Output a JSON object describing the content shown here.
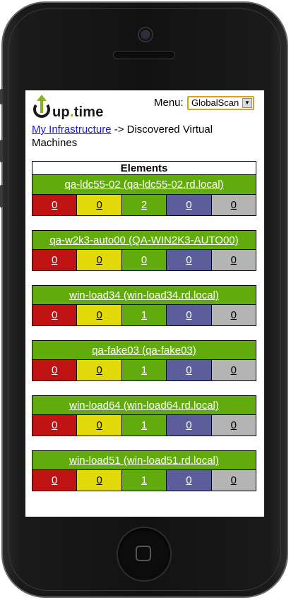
{
  "app": {
    "logo_text_a": "up",
    "logo_dot": ".",
    "logo_text_b": "time",
    "menu_label": "Menu:",
    "menu_selected": "GlobalScan"
  },
  "breadcrumb": {
    "link": "My Infrastructure",
    "rest": " -> Discovered Virtual Machines"
  },
  "elements_header": "Elements",
  "colors": {
    "critical": "#c01414",
    "warning": "#e2d90b",
    "ok": "#62ab0d",
    "maintenance": "#5c5e9c",
    "unknown": "#b4b4b4"
  },
  "vms": [
    {
      "title": "qa-ldc55-02 (qa-ldc55-02.rd.local)",
      "counts": [
        "0",
        "0",
        "2",
        "0",
        "0"
      ]
    },
    {
      "title": "qa-w2k3-auto00 (QA-WIN2K3-AUTO00)",
      "counts": [
        "0",
        "0",
        "0",
        "0",
        "0"
      ]
    },
    {
      "title": "win-load34 (win-load34.rd.local)",
      "counts": [
        "0",
        "0",
        "1",
        "0",
        "0"
      ]
    },
    {
      "title": "qa-fake03 (qa-fake03)",
      "counts": [
        "0",
        "0",
        "1",
        "0",
        "0"
      ]
    },
    {
      "title": "win-load64 (win-load64.rd.local)",
      "counts": [
        "0",
        "0",
        "1",
        "0",
        "0"
      ]
    },
    {
      "title": "win-load51 (win-load51.rd.local)",
      "counts": [
        "0",
        "0",
        "1",
        "0",
        "0"
      ]
    }
  ]
}
